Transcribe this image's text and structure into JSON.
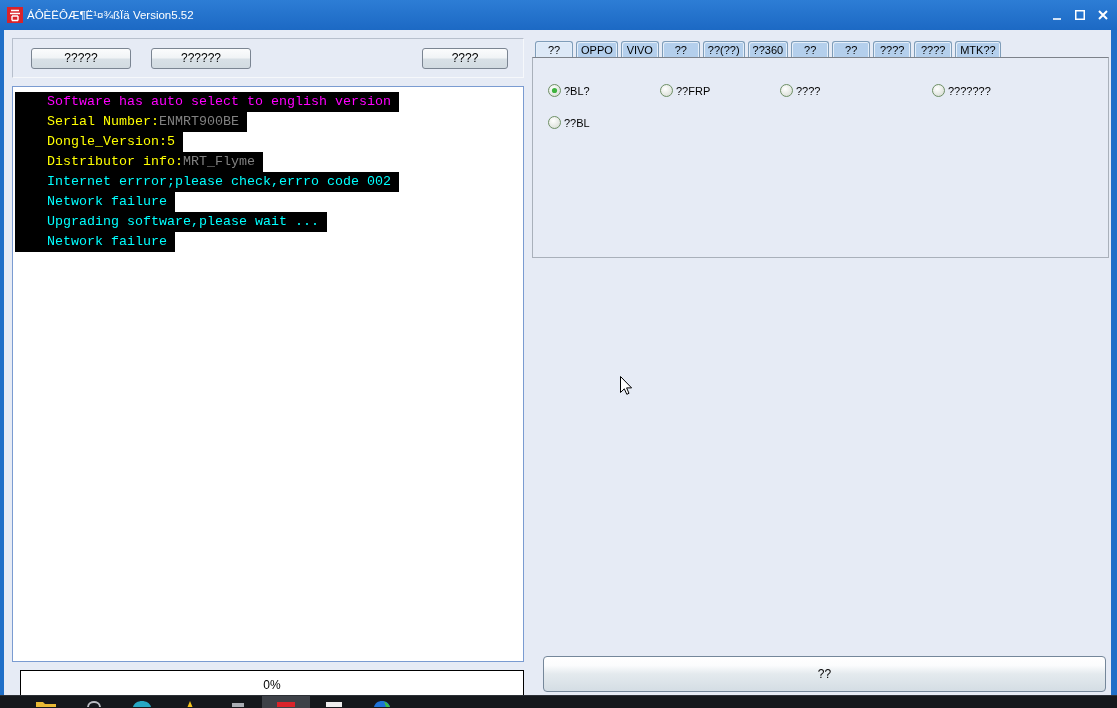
{
  "window": {
    "title": "ÁÔÈËÔÆ¶Ë¹¤¾ßÏä Version5.52"
  },
  "toolbar": {
    "buttons": [
      "?????",
      "??????",
      "????"
    ]
  },
  "log": {
    "lines": [
      {
        "segments": [
          {
            "text": "Software has auto select to english version",
            "color": "#ff00ff"
          }
        ]
      },
      {
        "segments": [
          {
            "text": "Serial Number:",
            "color": "#ffff00"
          },
          {
            "text": "ENMRT900BE",
            "color": "#808080"
          }
        ]
      },
      {
        "segments": [
          {
            "text": "Dongle_Version:5",
            "color": "#ffff00"
          }
        ]
      },
      {
        "segments": [
          {
            "text": "Distributor info:",
            "color": "#ffff00"
          },
          {
            "text": "MRT_Flyme",
            "color": "#808080"
          }
        ]
      },
      {
        "segments": [
          {
            "text": "Internet errror;please check,errro code 002",
            "color": "#00ffff"
          }
        ]
      },
      {
        "segments": [
          {
            "text": "Network failure",
            "color": "#00ffff"
          }
        ]
      },
      {
        "segments": [
          {
            "text": "Upgrading software,please wait ...",
            "color": "#00ffff"
          }
        ]
      },
      {
        "segments": [
          {
            "text": "Network failure",
            "color": "#00ffff"
          }
        ]
      }
    ]
  },
  "progress": {
    "level": 0,
    "reading": "0%"
  },
  "tabs": [
    {
      "label": "??",
      "selected": true
    },
    {
      "label": "OPPO",
      "selected": false
    },
    {
      "label": "VIVO",
      "selected": false
    },
    {
      "label": "??",
      "selected": false
    },
    {
      "label": "??(??)",
      "selected": false
    },
    {
      "label": "??360",
      "selected": false
    },
    {
      "label": "??",
      "selected": false
    },
    {
      "label": "??",
      "selected": false
    },
    {
      "label": "????",
      "selected": false
    },
    {
      "label": "????",
      "selected": false
    },
    {
      "label": "MTK??",
      "selected": false
    }
  ],
  "options": [
    {
      "label": "?BL?",
      "selected": true
    },
    {
      "label": "??FRP",
      "selected": false
    },
    {
      "label": "????",
      "selected": false
    },
    {
      "label": "???????",
      "selected": false
    },
    {
      "label": "??BL",
      "selected": false
    }
  ],
  "action_button": "??",
  "taskbar": {
    "items": [
      {
        "kind": "folder",
        "selected": false
      },
      {
        "kind": "arc",
        "selected": false
      },
      {
        "kind": "disc",
        "selected": false
      },
      {
        "kind": "triangle",
        "selected": false
      },
      {
        "kind": "bar",
        "selected": false
      },
      {
        "kind": "tile",
        "selected": true
      },
      {
        "kind": "page",
        "selected": false
      },
      {
        "kind": "globe",
        "selected": false
      }
    ]
  }
}
